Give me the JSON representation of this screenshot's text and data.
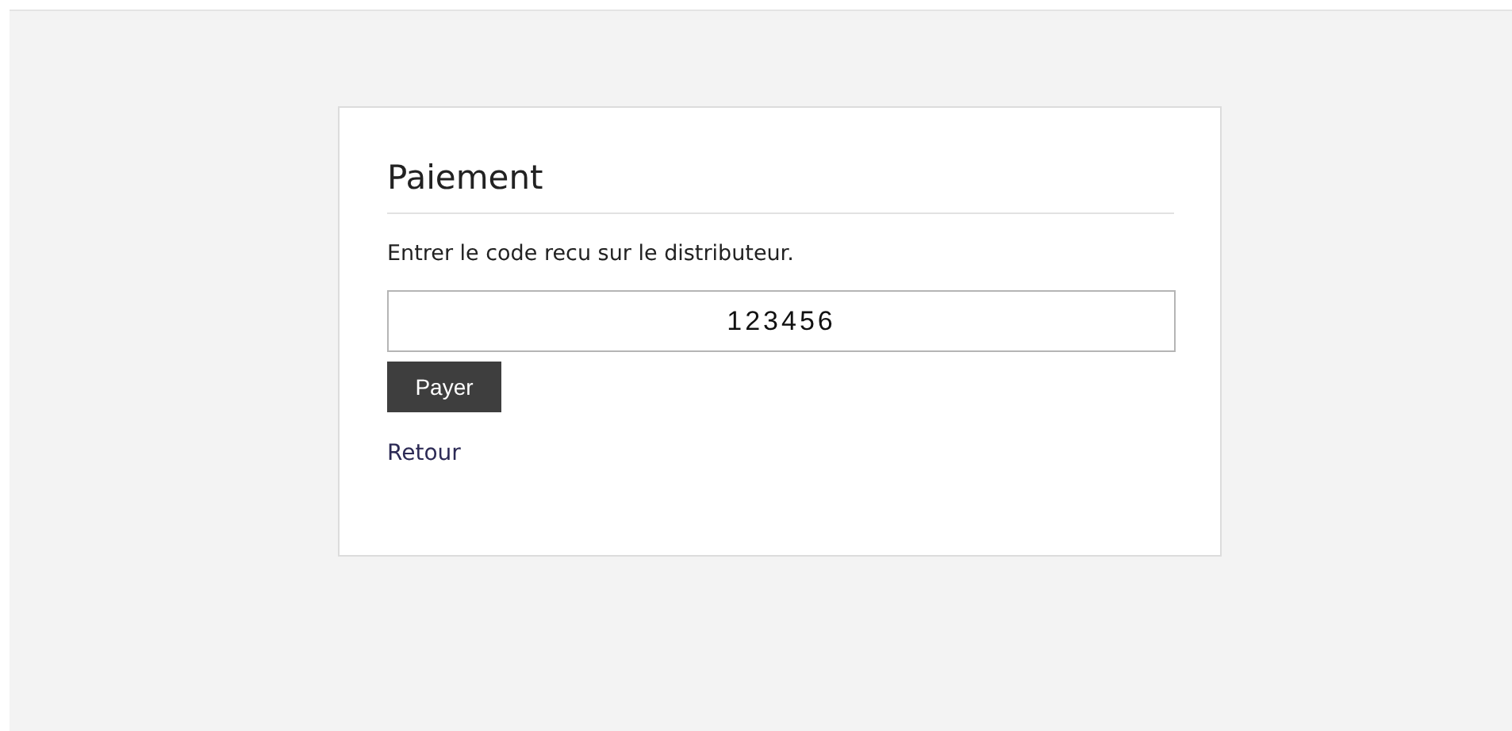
{
  "card": {
    "title": "Paiement",
    "instruction": "Entrer le code recu sur le distributeur.",
    "code_field": {
      "value": "123456"
    },
    "pay_button": "Payer",
    "back_link": "Retour"
  }
}
